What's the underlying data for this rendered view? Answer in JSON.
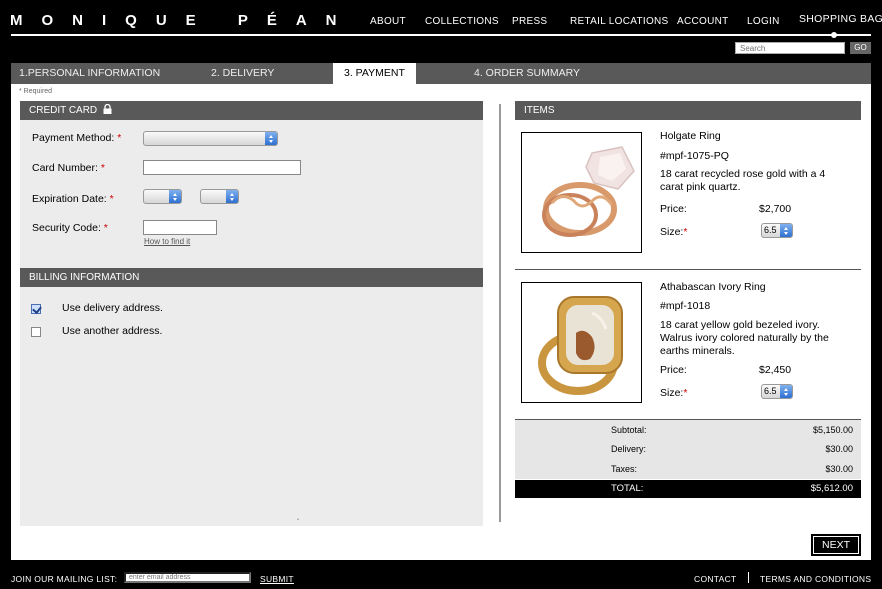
{
  "header": {
    "logo": "MONIQUE PÉAN",
    "nav": [
      "ABOUT",
      "COLLECTIONS",
      "PRESS",
      "RETAIL LOCATIONS",
      "ACCOUNT",
      "LOGIN"
    ],
    "bag_label": "SHOPPING BAG",
    "search_placeholder": "Search",
    "go_label": "GO"
  },
  "tabs": [
    "1.PERSONAL INFORMATION",
    "2. DELIVERY",
    "3. PAYMENT",
    "4. ORDER SUMMARY"
  ],
  "active_tab": "3. PAYMENT",
  "required_note": "* Required",
  "credit_card": {
    "title": "CREDIT CARD",
    "payment_method_label": "Payment Method:",
    "card_number_label": "Card Number:",
    "expiration_label": "Expiration Date:",
    "security_code_label": "Security Code:",
    "how_to_find": "How to find it",
    "required_mark": "*"
  },
  "billing": {
    "title": "BILLING INFORMATION",
    "options": [
      {
        "label": "Use delivery address.",
        "checked": true
      },
      {
        "label": "Use another address.",
        "checked": false
      }
    ]
  },
  "items": {
    "title": "ITEMS",
    "list": [
      {
        "name": "Holgate Ring",
        "sku": "#mpf-1075-PQ",
        "description": "18 carat recycled rose gold with a 4 carat pink quartz.",
        "price_label": "Price:",
        "price": "$2,700",
        "size_label": "Size:",
        "size": "6.5"
      },
      {
        "name": "Athabascan Ivory Ring",
        "sku": "#mpf-1018",
        "description": "18 carat yellow gold bezeled ivory. Walrus ivory colored naturally by the earths minerals.",
        "price_label": "Price:",
        "price": "$2,450",
        "size_label": "Size:",
        "size": "6.5"
      }
    ]
  },
  "totals": {
    "subtotal_label": "Subtotal:",
    "subtotal": "$5,150.00",
    "delivery_label": "Delivery:",
    "delivery": "$30.00",
    "taxes_label": "Taxes:",
    "taxes": "$30.00",
    "total_label": "TOTAL:",
    "total": "$5,612.00"
  },
  "next_label": "NEXT",
  "footer": {
    "mailing_label": "JOIN OUR MAILING LIST:",
    "email_placeholder": "enter email address",
    "submit_label": "SUBMIT",
    "contact_label": "CONTACT",
    "terms_label": "TERMS AND CONDITIONS"
  },
  "colors": {
    "bar": "#595959",
    "panel": "#ececec",
    "required": "#cc0000"
  }
}
